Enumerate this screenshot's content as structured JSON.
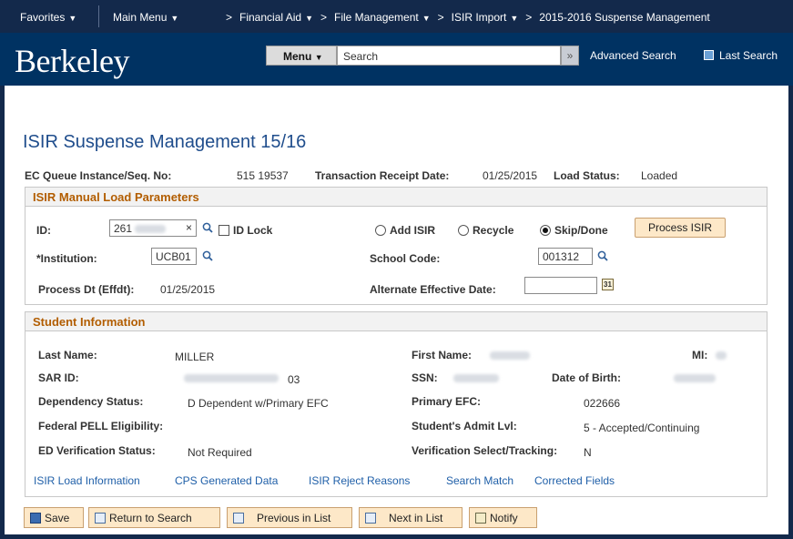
{
  "nav": {
    "favorites": "Favorites",
    "main_menu": "Main Menu",
    "crumbs": [
      "Financial Aid",
      "File Management",
      "ISIR Import"
    ],
    "current": "2015-2016 Suspense Management"
  },
  "header": {
    "logo": "Berkeley",
    "menu_label": "Menu",
    "search_placeholder": "Search",
    "advanced_search": "Advanced Search",
    "last_search": "Last Search"
  },
  "page": {
    "title": "ISIR Suspense Management 15/16",
    "ec_queue_label": "EC Queue Instance/Seq. No:",
    "ec_queue_value": "515  19537",
    "trans_receipt_label": "Transaction Receipt Date:",
    "trans_receipt_value": "01/25/2015",
    "load_status_label": "Load Status:",
    "load_status_value": "Loaded"
  },
  "params": {
    "header": "ISIR Manual Load Parameters",
    "id_label": "ID:",
    "id_value": "261",
    "id_lock_label": "ID Lock",
    "add_isir": "Add ISIR",
    "recycle": "Recycle",
    "skip_done": "Skip/Done",
    "process_button": "Process ISIR",
    "institution_label": "*Institution:",
    "institution_value": "UCB01",
    "school_code_label": "School Code:",
    "school_code_value": "001312",
    "process_dt_label": "Process Dt (Effdt):",
    "process_dt_value": "01/25/2015",
    "alt_eff_date_label": "Alternate Effective Date:"
  },
  "student": {
    "header": "Student Information",
    "last_name_label": "Last Name:",
    "last_name_value": "MILLER",
    "first_name_label": "First Name:",
    "mi_label": "MI:",
    "sar_id_label": "SAR ID:",
    "sar_id_suffix": "03",
    "ssn_label": "SSN:",
    "dob_label": "Date of Birth:",
    "dependency_label": "Dependency Status:",
    "dependency_value": "D  Dependent w/Primary EFC",
    "primary_efc_label": "Primary EFC:",
    "primary_efc_value": "022666",
    "pell_label": "Federal PELL Eligibility:",
    "admit_lvl_label": "Student's Admit Lvl:",
    "admit_lvl_value": "5 - Accepted/Continuing",
    "ed_verif_label": "ED Verification Status:",
    "ed_verif_value": "Not Required",
    "verif_select_label": "Verification Select/Tracking:",
    "verif_select_value": "N"
  },
  "links": [
    "ISIR Load Information",
    "CPS Generated Data",
    "ISIR Reject Reasons",
    "Search Match",
    "Corrected Fields"
  ],
  "toolbar": {
    "save": "Save",
    "return": "Return to Search",
    "previous": "Previous in List",
    "next": "Next in List",
    "notify": "Notify"
  },
  "colors": {
    "nav_bg": "#13294b",
    "brand_bg": "#003262",
    "section_head": "#b25d00",
    "title": "#1f4d8c",
    "link": "#1f5fa8",
    "button_bg": "#fde8c8"
  }
}
